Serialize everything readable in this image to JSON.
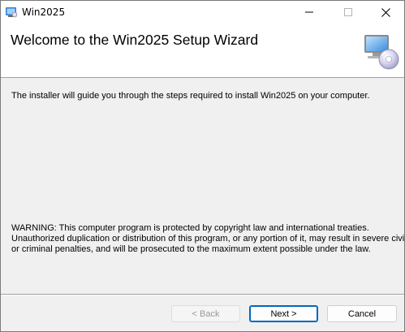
{
  "window": {
    "title": "Win2025",
    "controls": {
      "minimize": "minimize-icon",
      "maximize": "maximize-icon",
      "close": "close-icon"
    }
  },
  "banner": {
    "title": "Welcome to the Win2025 Setup Wizard",
    "icon": "computer-cd-icon"
  },
  "content": {
    "intro": "The installer will guide you through the steps required to install Win2025 on your computer.",
    "warning_lines": [
      "WARNING: This computer program is protected by copyright law and international treaties.",
      "Unauthorized duplication or distribution of this program, or any portion of it, may result in severe civil",
      "or criminal penalties, and will be prosecuted to the maximum extent possible under the law."
    ]
  },
  "buttons": {
    "back": {
      "label": "< Back",
      "enabled": false
    },
    "next": {
      "label": "Next >",
      "enabled": true,
      "default": true
    },
    "cancel": {
      "label": "Cancel",
      "enabled": true
    }
  },
  "colors": {
    "accent": "#0067c0",
    "dialog_background": "#f0f0f0",
    "banner_background": "#ffffff"
  }
}
